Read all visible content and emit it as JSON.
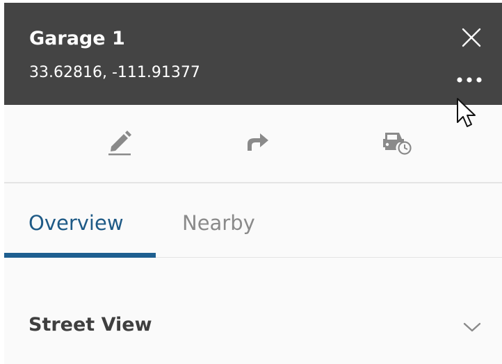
{
  "header": {
    "title": "Garage 1",
    "coordinates": "33.62816, -111.91377",
    "close_icon": "close-icon",
    "more_icon": "more-options-icon",
    "background": "#444444"
  },
  "actions": [
    {
      "name": "edit",
      "icon": "pencil-icon"
    },
    {
      "name": "directions",
      "icon": "share-arrow-icon"
    },
    {
      "name": "travel-time",
      "icon": "car-clock-icon"
    }
  ],
  "tabs": [
    {
      "label": "Overview",
      "selected": true
    },
    {
      "label": "Nearby",
      "selected": false
    }
  ],
  "sections": {
    "street_view_label": "Street View",
    "street_view_icon": "chevron-down-icon"
  },
  "colors": {
    "accent": "#1e5f90",
    "tab_inactive": "#8a8a8a",
    "icon_gray": "#8a8a8a"
  }
}
